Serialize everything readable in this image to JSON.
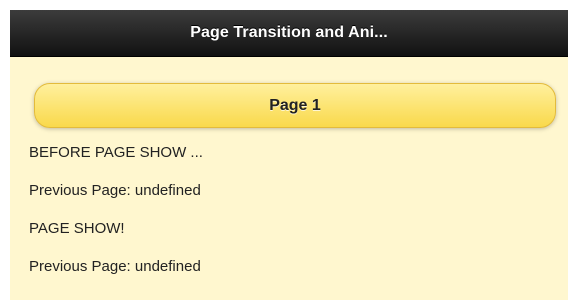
{
  "header": {
    "title": "Page Transition and Ani..."
  },
  "main": {
    "button_label": "Page 1",
    "log": [
      "BEFORE PAGE SHOW ...",
      "Previous Page: undefined",
      "PAGE SHOW!",
      "Previous Page: undefined"
    ]
  },
  "colors": {
    "header_bg": "#151515",
    "page_bg": "#fff7cf",
    "button_bg": "#f9d94b",
    "button_border": "#e3bb3b"
  }
}
